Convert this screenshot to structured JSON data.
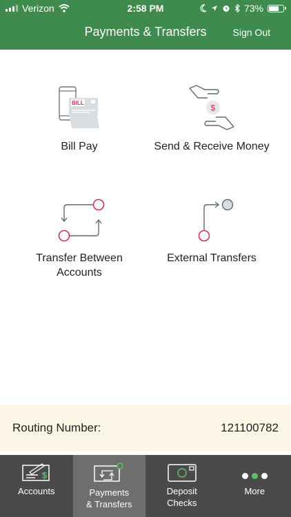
{
  "status_bar": {
    "carrier": "Verizon",
    "time": "2:58 PM",
    "battery": "73%",
    "battery_level": 0.73
  },
  "header": {
    "title": "Payments & Transfers",
    "sign_out": "Sign Out"
  },
  "tiles": [
    {
      "label": "Bill Pay",
      "icon": "bill-pay-icon",
      "bill_text": "BILL"
    },
    {
      "label": "Send & Receive Money",
      "icon": "send-receive-money-icon",
      "currency": "$"
    },
    {
      "label": "Transfer Between\nAccounts",
      "icon": "transfer-between-icon"
    },
    {
      "label": "External Transfers",
      "icon": "external-transfers-icon"
    }
  ],
  "routing": {
    "label": "Routing Number:",
    "value": "121100782"
  },
  "tabbar": {
    "items": [
      {
        "label": "Accounts",
        "icon": "check-icon",
        "active": false
      },
      {
        "label": "Payments\n& Transfers",
        "icon": "transfer-icon",
        "active": true
      },
      {
        "label": "Deposit\nChecks",
        "icon": "deposit-check-icon",
        "active": false
      },
      {
        "label": "More",
        "icon": "more-dots-icon",
        "active": false
      }
    ]
  },
  "colors": {
    "brand_green": "#3f8a4d",
    "accent_red": "#c8325a",
    "tabbar_bg": "#4a4a4a",
    "routing_bg": "#fbf6e6"
  }
}
